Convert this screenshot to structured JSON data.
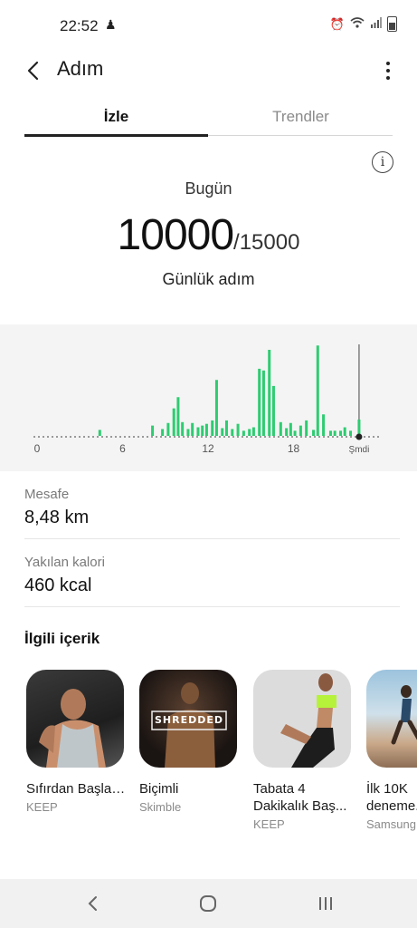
{
  "status_bar": {
    "time": "22:52"
  },
  "app_bar": {
    "title": "Adım"
  },
  "tabs": [
    {
      "label": "İzle",
      "active": true
    },
    {
      "label": "Trendler",
      "active": false
    }
  ],
  "summary": {
    "day_label": "Bugün",
    "steps": "10000",
    "goal": "/15000",
    "caption": "Günlük adım"
  },
  "chart_data": {
    "type": "bar",
    "x_ticks": [
      "0",
      "6",
      "12",
      "18",
      "Şmdi"
    ],
    "xlim": [
      0,
      24
    ],
    "bars": [
      {
        "x": 4.4,
        "v": 0.07
      },
      {
        "x": 8.1,
        "v": 0.12
      },
      {
        "x": 8.8,
        "v": 0.08
      },
      {
        "x": 9.2,
        "v": 0.15
      },
      {
        "x": 9.6,
        "v": 0.32
      },
      {
        "x": 9.9,
        "v": 0.45
      },
      {
        "x": 10.2,
        "v": 0.16
      },
      {
        "x": 10.6,
        "v": 0.08
      },
      {
        "x": 10.9,
        "v": 0.15
      },
      {
        "x": 11.3,
        "v": 0.1
      },
      {
        "x": 11.6,
        "v": 0.12
      },
      {
        "x": 11.9,
        "v": 0.14
      },
      {
        "x": 12.3,
        "v": 0.18
      },
      {
        "x": 12.6,
        "v": 0.65
      },
      {
        "x": 13.0,
        "v": 0.09
      },
      {
        "x": 13.3,
        "v": 0.18
      },
      {
        "x": 13.7,
        "v": 0.08
      },
      {
        "x": 14.1,
        "v": 0.14
      },
      {
        "x": 14.5,
        "v": 0.06
      },
      {
        "x": 14.9,
        "v": 0.08
      },
      {
        "x": 15.2,
        "v": 0.1
      },
      {
        "x": 15.6,
        "v": 0.78
      },
      {
        "x": 15.9,
        "v": 0.76
      },
      {
        "x": 16.3,
        "v": 1.0
      },
      {
        "x": 16.6,
        "v": 0.58
      },
      {
        "x": 17.1,
        "v": 0.16
      },
      {
        "x": 17.5,
        "v": 0.09
      },
      {
        "x": 17.8,
        "v": 0.15
      },
      {
        "x": 18.1,
        "v": 0.06
      },
      {
        "x": 18.5,
        "v": 0.12
      },
      {
        "x": 18.9,
        "v": 0.18
      },
      {
        "x": 19.4,
        "v": 0.07
      },
      {
        "x": 19.7,
        "v": 1.05
      },
      {
        "x": 20.1,
        "v": 0.25
      },
      {
        "x": 20.6,
        "v": 0.06
      },
      {
        "x": 20.9,
        "v": 0.06
      },
      {
        "x": 21.3,
        "v": 0.06
      },
      {
        "x": 21.6,
        "v": 0.1
      },
      {
        "x": 22.0,
        "v": 0.06
      },
      {
        "x": 22.6,
        "v": 0.19
      }
    ],
    "now_marker": 22.6,
    "bar_color": "#2ecc71"
  },
  "stats": [
    {
      "label": "Mesafe",
      "value": "8,48 km"
    },
    {
      "label": "Yakılan kalori",
      "value": "460 kcal"
    }
  ],
  "related": {
    "title": "İlgili içerik",
    "items": [
      {
        "title": "Sıfırdan Başlayarak U...",
        "source": "KEEP"
      },
      {
        "title": "Biçimli",
        "source": "Skimble",
        "badge": "SHREDDED"
      },
      {
        "title": "Tabata 4 Dakikalık Baş...",
        "source": "KEEP"
      },
      {
        "title": "İlk 10K deneme...",
        "source": "Samsung"
      }
    ]
  },
  "colors": {
    "accent_green": "#2ecc71",
    "chart_bg": "#f4f4f4",
    "nav_bg": "#f1f1f1"
  }
}
